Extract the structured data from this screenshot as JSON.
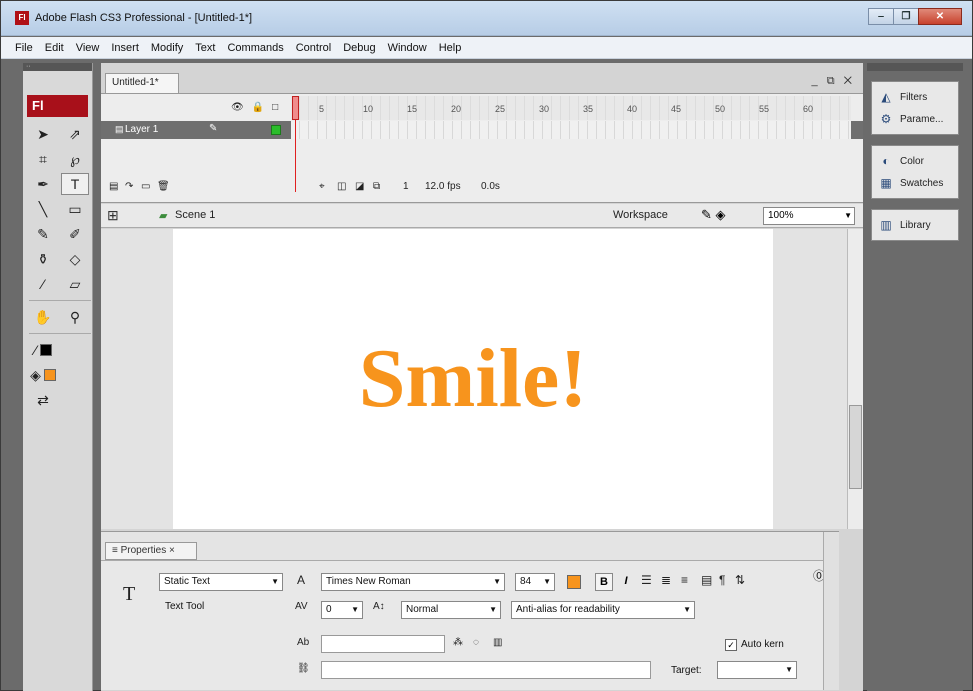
{
  "window": {
    "title": "Adobe Flash CS3 Professional - [Untitled-1*]",
    "app_icon": "Fl"
  },
  "menu": [
    "File",
    "Edit",
    "View",
    "Insert",
    "Modify",
    "Text",
    "Commands",
    "Control",
    "Debug",
    "Window",
    "Help"
  ],
  "tools": {
    "logo": "Fl"
  },
  "document": {
    "tab_label": "Untitled-1*",
    "controls": "_ ⧉ ✕"
  },
  "timeline": {
    "ruler_numbers": [
      "5",
      "10",
      "15",
      "20",
      "25",
      "30",
      "35",
      "40",
      "45",
      "50",
      "55",
      "60"
    ],
    "layer_name": "Layer 1",
    "frame_number": "1",
    "fps": "12.0 fps",
    "time": "0.0s"
  },
  "edit_bar": {
    "scene": "Scene 1",
    "workspace": "Workspace",
    "zoom": "100%"
  },
  "stage": {
    "text": "Smile!",
    "text_color": "#f7941d"
  },
  "properties": {
    "tab": "Properties",
    "text_type": "Static Text",
    "tool_label": "Text Tool",
    "font": "Times New Roman",
    "size": "84",
    "letter_spacing": "0",
    "position": "Normal",
    "anti_alias": "Anti-alias for readability",
    "auto_kern": "Auto kern",
    "target_label": "Target:"
  },
  "panels": {
    "group1": [
      "Filters",
      "Parame..."
    ],
    "group2": [
      "Color",
      "Swatches"
    ],
    "group3": [
      "Library"
    ]
  }
}
